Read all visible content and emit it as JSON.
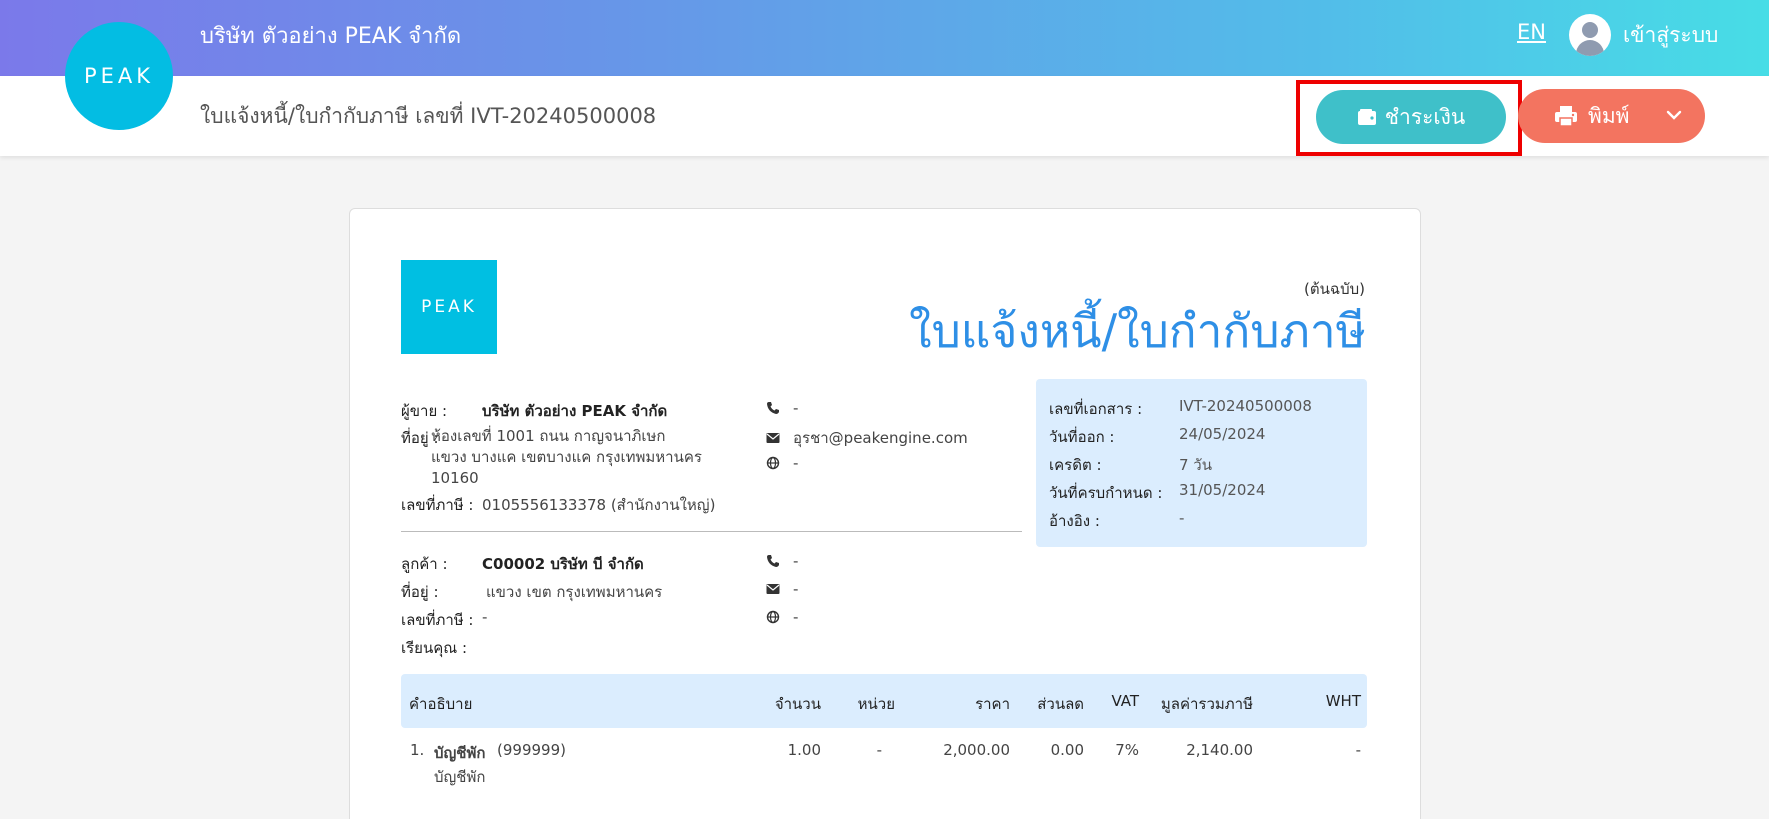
{
  "header": {
    "company": "บริษัท ตัวอย่าง PEAK จำกัด",
    "lang": "EN",
    "login": "เข้าสู่ระบบ",
    "logo_text": "PEAK",
    "doc_title": "ใบแจ้งหนี้/ใบกำกับภาษี เลขที่  IVT-20240500008",
    "pay_button": "ชำระเงิน",
    "print_button": "พิมพ์",
    "icons": {
      "pay": "wallet-icon",
      "print": "printer-icon",
      "dropdown": "chevron-down-icon",
      "user": "user-avatar-icon"
    },
    "colors": {
      "pay": "#3fc0c9",
      "print": "#f37460",
      "highlight": "#ee0000",
      "brand": "#03bde3"
    }
  },
  "document": {
    "logo_text": "PEAK",
    "copy_label": "(ต้นฉบับ)",
    "title": "ใบแจ้งหนี้/ใบกำกับภาษี",
    "seller": {
      "name_label": "ผู้ขาย :",
      "name": "บริษัท ตัวอย่าง PEAK จำกัด",
      "address_label": "ที่อยู่ :",
      "address": "ห้องเลขที่ 1001 ถนน กาญจนาภิเษก แขวง บางแค เขตบางแค กรุงเทพมหานคร 10160",
      "tax_label": "เลขที่ภาษี :",
      "tax": "0105556133378 (สำนักงานใหญ่)",
      "phone": "-",
      "email": "อุรชา@peakengine.com",
      "website": "-"
    },
    "customer": {
      "name_label": "ลูกค้า :",
      "name": "C00002 บริษัท บี จำกัด",
      "address_label": "ที่อยู่ :",
      "address": "แขวง เขต กรุงเทพมหานคร",
      "tax_label": "เลขที่ภาษี :",
      "tax": "-",
      "attn_label": "เรียนคุณ :",
      "phone": "-",
      "email": "-",
      "website": "-"
    },
    "info": {
      "doc_no_label": "เลขที่เอกสาร :",
      "doc_no": "IVT-20240500008",
      "issue_label": "วันที่ออก :",
      "issue": "24/05/2024",
      "credit_label": "เครดิต :",
      "credit": "7 วัน",
      "due_label": "วันที่ครบกำหนด :",
      "due": "31/05/2024",
      "ref_label": "อ้างอิง :",
      "ref": "-"
    },
    "table": {
      "headers": {
        "description": "คำอธิบาย",
        "qty": "จำนวน",
        "unit": "หน่วย",
        "price": "ราคา",
        "discount": "ส่วนลด",
        "vat": "VAT",
        "total": "มูลค่ารวมภาษี",
        "wht": "WHT"
      },
      "rows": [
        {
          "no": "1.",
          "name": "บัญชีพัก",
          "code": "(999999)",
          "sub": "บัญชีพัก",
          "qty": "1.00",
          "unit": "-",
          "price": "2,000.00",
          "discount": "0.00",
          "vat": "7%",
          "total": "2,140.00",
          "wht": "-"
        }
      ]
    }
  }
}
